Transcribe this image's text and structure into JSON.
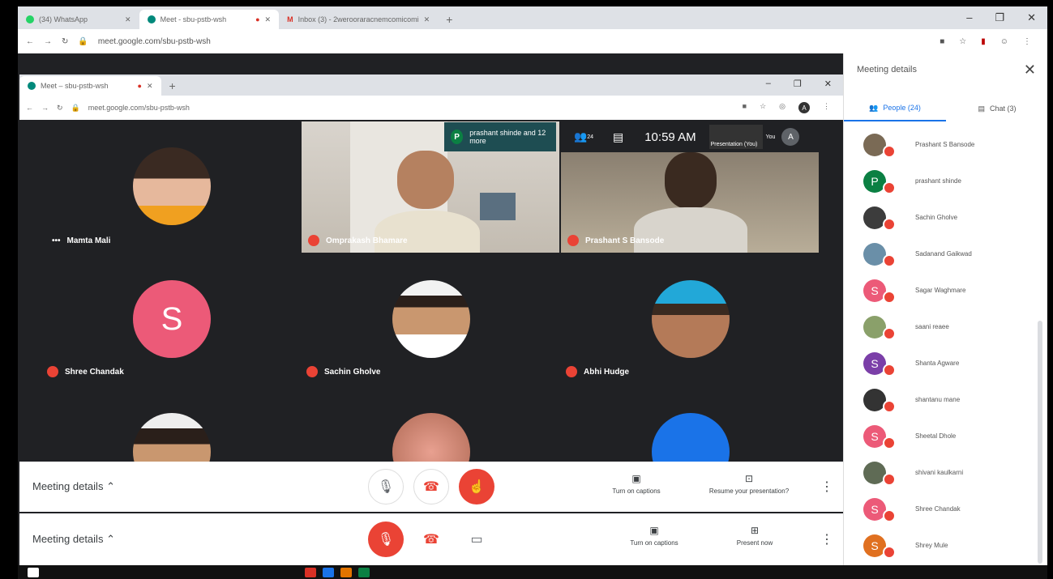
{
  "outer_browser": {
    "tabs": [
      {
        "label": "(34) WhatsApp",
        "active": false
      },
      {
        "label": "Meet - sbu-pstb-wsh",
        "active": true
      },
      {
        "label": "Inbox (3) - 2werooraracnemcomicomi",
        "active": false
      }
    ],
    "url": "meet.google.com/sbu-pstb-wsh"
  },
  "inner_browser": {
    "tab": "Meet – sbu-pstb-wsh",
    "url": "meet.google.com/sbu-pstb-wsh"
  },
  "meeting_topbar": {
    "chip_initial": "P",
    "chip_text": "prashant shinde and 12 more",
    "people_count": "24",
    "time": "10:59 AM",
    "presentation_label": "Presentation (You)",
    "you_label": "You"
  },
  "tiles": [
    {
      "name": "Mamta Mali",
      "kind": "photo",
      "prefix": "•••"
    },
    {
      "name": "Omprakash Bhamare",
      "kind": "video"
    },
    {
      "name": "Prashant S Bansode",
      "kind": "video"
    },
    {
      "name": "Shree Chandak",
      "kind": "letter",
      "letter": "S",
      "color": "#ec5a78"
    },
    {
      "name": "Sachin Gholve",
      "kind": "photo"
    },
    {
      "name": "Abhi Hudge",
      "kind": "photo"
    }
  ],
  "controls_top": {
    "meeting_details": "Meeting details",
    "captions": "Turn on captions",
    "present": "Resume your presentation?"
  },
  "controls_bottom": {
    "meeting_details": "Meeting details",
    "captions": "Turn on captions",
    "present": "Present now"
  },
  "side_panel": {
    "title": "Meeting details",
    "people_tab": "People (24)",
    "chat_tab": "Chat (3)",
    "people": [
      {
        "name": "Prashant S Bansode",
        "letter": "",
        "color": "#7a6a55"
      },
      {
        "name": "prashant shinde",
        "letter": "P",
        "color": "#0b8043"
      },
      {
        "name": "Sachin Gholve",
        "letter": "",
        "color": "#3c3c3c"
      },
      {
        "name": "Sadanand Gaikwad",
        "letter": "",
        "color": "#6a8fa8"
      },
      {
        "name": "Sagar Waghmare",
        "letter": "S",
        "color": "#ec5a78"
      },
      {
        "name": "saani reaee",
        "letter": "",
        "color": "#8aa06a"
      },
      {
        "name": "Shanta Agware",
        "letter": "S",
        "color": "#7b3fa8"
      },
      {
        "name": "shantanu mane",
        "letter": "",
        "color": "#333333"
      },
      {
        "name": "Sheetal Dhole",
        "letter": "S",
        "color": "#ec5a78"
      },
      {
        "name": "shivani kaulkarni",
        "letter": "",
        "color": "#5f6b55"
      },
      {
        "name": "Shree Chandak",
        "letter": "S",
        "color": "#ec5a78"
      },
      {
        "name": "Shrey Mule",
        "letter": "S",
        "color": "#e07020"
      }
    ]
  },
  "colors": {
    "accent": "#1a73e8",
    "end_call": "#ea4335",
    "meet_bg": "#202124"
  }
}
